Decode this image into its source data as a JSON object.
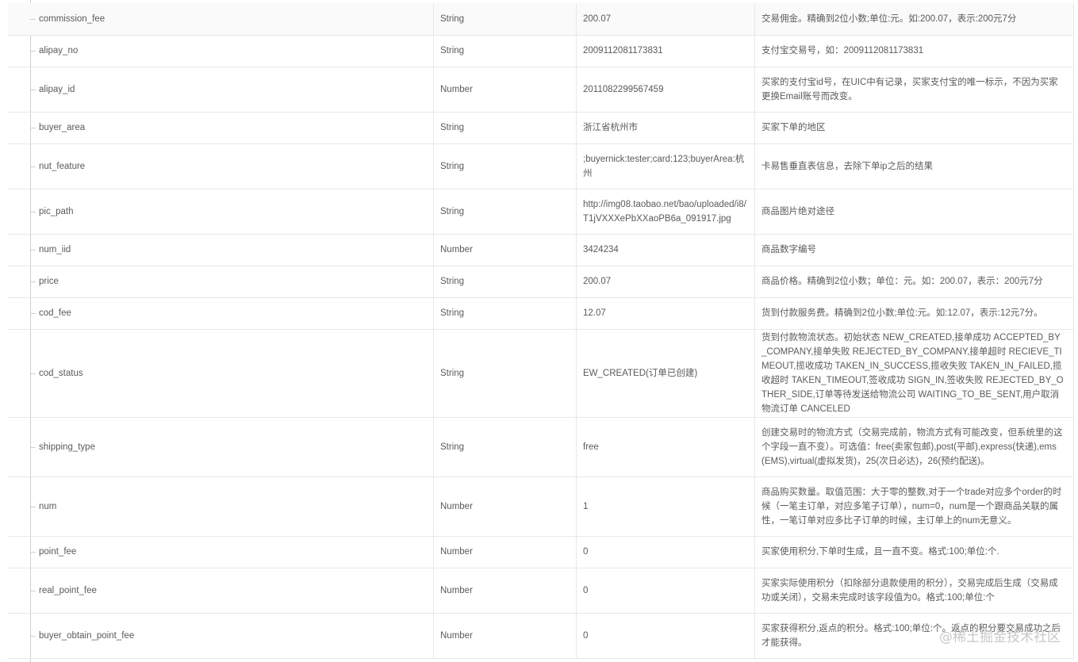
{
  "rows": [
    {
      "name": "commission_fee",
      "type": "String",
      "example": "200.07",
      "desc": "交易佣金。精确到2位小数;单位:元。如:200.07，表示:200元7分"
    },
    {
      "name": "alipay_no",
      "type": "String",
      "example": "2009112081173831",
      "desc": "支付宝交易号，如：2009112081173831"
    },
    {
      "name": "alipay_id",
      "type": "Number",
      "example": "2011082299567459",
      "desc": "买家的支付宝id号，在UIC中有记录，买家支付宝的唯一标示，不因为买家更换Email账号而改变。"
    },
    {
      "name": "buyer_area",
      "type": "String",
      "example": "浙江省杭州市",
      "desc": "买家下单的地区"
    },
    {
      "name": "nut_feature",
      "type": "String",
      "example": ";buyernick:tester;card:123;buyerArea:杭州",
      "desc": "卡易售垂直表信息，去除下单ip之后的结果"
    },
    {
      "name": "pic_path",
      "type": "String",
      "example": "http://img08.taobao.net/bao/uploaded/i8/T1jVXXXePbXXaoPB6a_091917.jpg",
      "desc": "商品图片绝对途径"
    },
    {
      "name": "num_iid",
      "type": "Number",
      "example": "3424234",
      "desc": "商品数字编号"
    },
    {
      "name": "price",
      "type": "String",
      "example": "200.07",
      "desc": "商品价格。精确到2位小数；单位：元。如：200.07，表示：200元7分"
    },
    {
      "name": "cod_fee",
      "type": "String",
      "example": "12.07",
      "desc": "货到付款服务费。精确到2位小数;单位:元。如:12.07，表示:12元7分。"
    },
    {
      "name": "cod_status",
      "type": "String",
      "example": "EW_CREATED(订单已创建)",
      "desc": "货到付款物流状态。初始状态 NEW_CREATED,接单成功 ACCEPTED_BY_COMPANY,接单失败 REJECTED_BY_COMPANY,接单超时 RECIEVE_TIMEOUT,揽收成功 TAKEN_IN_SUCCESS,揽收失败 TAKEN_IN_FAILED,揽收超时 TAKEN_TIMEOUT,签收成功 SIGN_IN,签收失败 REJECTED_BY_OTHER_SIDE,订单等待发送给物流公司 WAITING_TO_BE_SENT,用户取消物流订单 CANCELED"
    },
    {
      "name": "shipping_type",
      "type": "String",
      "example": "free",
      "desc": "创建交易时的物流方式（交易完成前，物流方式有可能改变，但系统里的这个字段一直不变）。可选值：free(卖家包邮),post(平邮),express(快递),ems(EMS),virtual(虚拟发货)，25(次日必达)，26(预约配送)。"
    },
    {
      "name": "num",
      "type": "Number",
      "example": "1",
      "desc": "商品购买数量。取值范围：大于零的整数,对于一个trade对应多个order的时候（一笔主订单，对应多笔子订单），num=0，num是一个跟商品关联的属性，一笔订单对应多比子订单的时候，主订单上的num无意义。"
    },
    {
      "name": "point_fee",
      "type": "Number",
      "example": "0",
      "desc": "买家使用积分,下单时生成，且一直不变。格式:100;单位:个."
    },
    {
      "name": "real_point_fee",
      "type": "Number",
      "example": "0",
      "desc": "买家实际使用积分（扣除部分退款使用的积分），交易完成后生成（交易成功或关闭），交易未完成时该字段值为0。格式:100;单位:个"
    },
    {
      "name": "buyer_obtain_point_fee",
      "type": "Number",
      "example": "0",
      "desc": "买家获得积分,返点的积分。格式:100;单位:个。返点的积分要交易成功之后才能获得。"
    }
  ],
  "watermark": "@稀土掘金技术社区"
}
